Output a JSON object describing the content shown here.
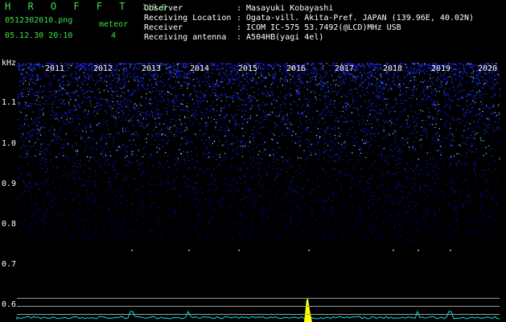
{
  "app": {
    "name": "H R O F F T",
    "version": "1.0.0",
    "filename": "0512302010.png",
    "datetime": "05.12.30 20:10",
    "meteor_label": "meteor",
    "meteor_count": "4"
  },
  "info": {
    "labels": [
      "Observer",
      "Receiving Location",
      "Receiver",
      "Receiving antenna"
    ],
    "values": [
      ": Masayuki Kobayashi",
      ": Ogata-vill. Akita-Pref. JAPAN (139.96E, 40.02N)",
      ": ICOM IC-575 53.7492(@LCD)MHz USB",
      ": A504HB(yagi 4el)"
    ]
  },
  "spectrogram": {
    "unit_label": "kHz",
    "y_ticks": [
      "1.1",
      "1.0",
      "0.9",
      "0.8",
      "0.7",
      "0.6"
    ],
    "top_labels": [
      "2011",
      "2012",
      "2013",
      "2014",
      "2015",
      "2016",
      "2017",
      "2018",
      "2019",
      "2020"
    ],
    "colors": {
      "background": "#000000",
      "noise": "#2a3cff",
      "peak": "#ffff00",
      "trace": "#00e5e5",
      "label_green": "#3fe04a"
    }
  }
}
